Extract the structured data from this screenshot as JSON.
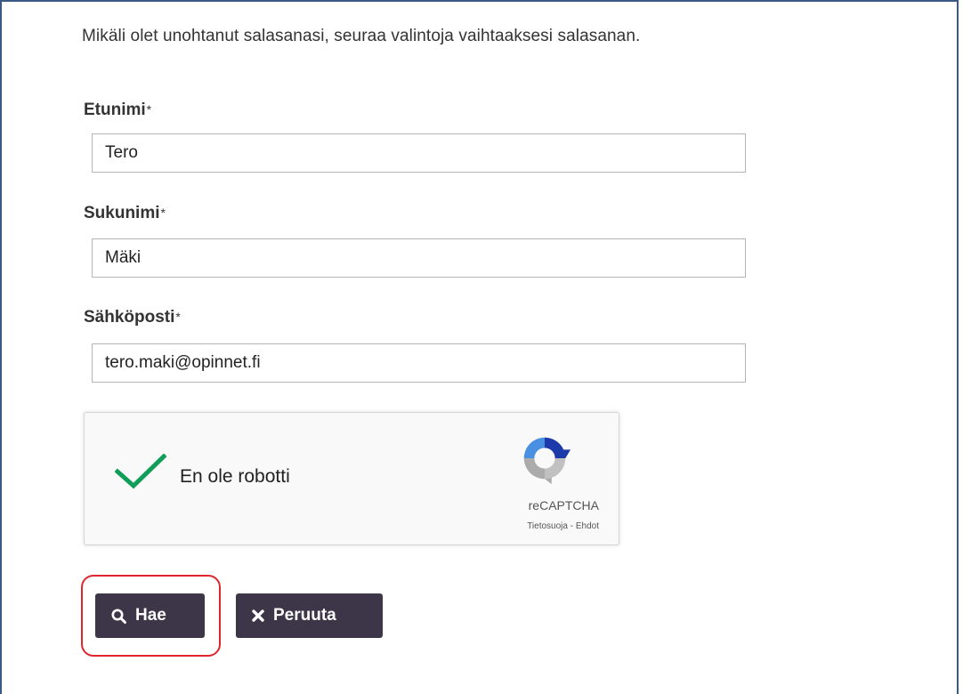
{
  "form": {
    "intro": "Mikäli olet unohtanut salasanasi, seuraa valintoja vaihtaaksesi salasanan.",
    "required_marker": "*",
    "fields": [
      {
        "label": "Etunimi",
        "value": "Tero"
      },
      {
        "label": "Sukunimi",
        "value": "Mäki"
      },
      {
        "label": "Sähköposti",
        "value": "tero.maki@opinnet.fi"
      }
    ]
  },
  "captcha": {
    "label": "En ole robotti",
    "checked": true,
    "brand": "reCAPTCHA",
    "privacy_link": "Tietosuoja",
    "separator": " - ",
    "terms_link": "Ehdot",
    "check_color": "#0f9d58"
  },
  "actions": {
    "search_label": "Hae",
    "search_icon": "search-icon",
    "cancel_label": "Peruuta",
    "cancel_icon": "close-icon",
    "button_color": "#3d3548",
    "highlight_color": "#e0262c"
  }
}
